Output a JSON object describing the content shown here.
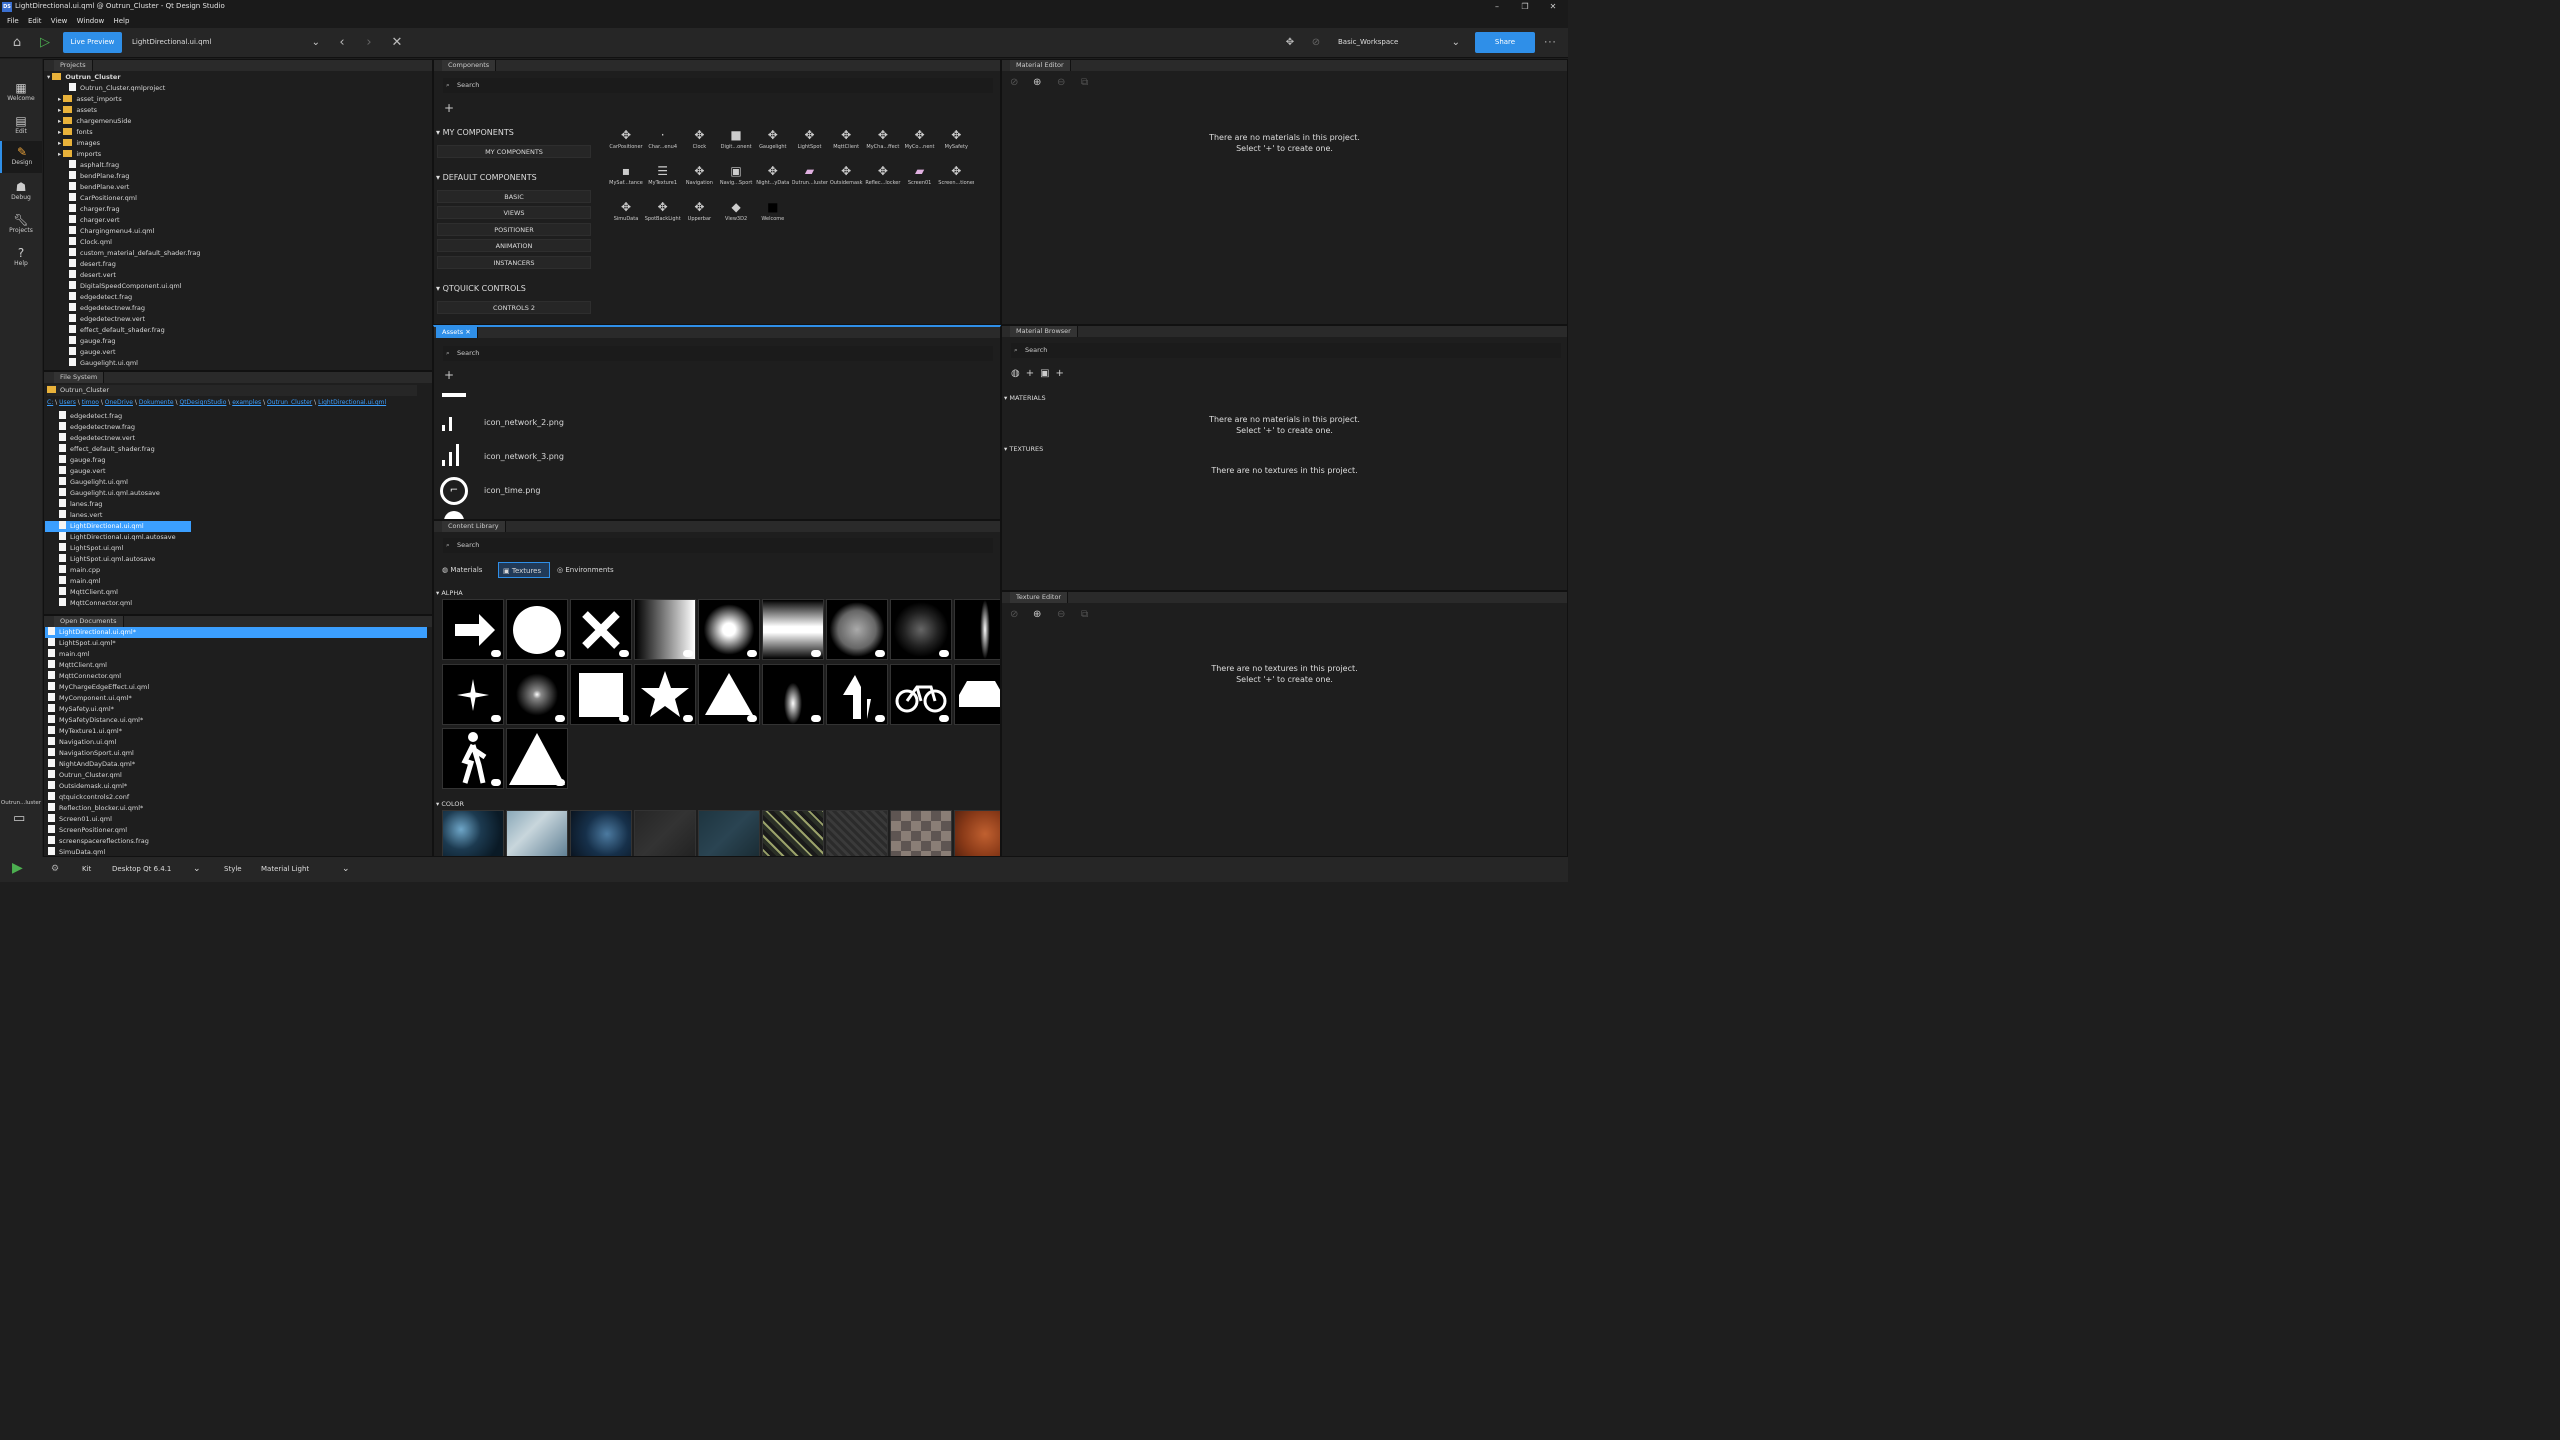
{
  "window": {
    "title": "LightDirectional.ui.qml @ Outrun_Cluster - Qt Design Studio",
    "logo": "DS",
    "controls": [
      "–",
      "❐",
      "✕"
    ]
  },
  "menu": [
    "File",
    "Edit",
    "View",
    "Window",
    "Help"
  ],
  "toolbar": {
    "live_preview": "Live Preview",
    "current_file": "LightDirectional.ui.qml",
    "workspace": "Basic_Workspace",
    "share": "Share"
  },
  "modes": [
    {
      "label": "Welcome",
      "icon": "grid-icon"
    },
    {
      "label": "Edit",
      "icon": "edit-icon"
    },
    {
      "label": "Design",
      "icon": "pencil-icon"
    },
    {
      "label": "Debug",
      "icon": "bug-icon"
    },
    {
      "label": "Projects",
      "icon": "wrench-icon"
    },
    {
      "label": "Help",
      "icon": "help-icon"
    }
  ],
  "modebar_bottom": {
    "project_label": "Outrun...luster"
  },
  "projects": {
    "tab": "Projects",
    "root": "Outrun_Cluster",
    "items": [
      {
        "name": "Outrun_Cluster.qmlproject",
        "type": "file"
      },
      {
        "name": "asset_imports",
        "type": "folder"
      },
      {
        "name": "assets",
        "type": "folder"
      },
      {
        "name": "chargemenuSide",
        "type": "folder"
      },
      {
        "name": "fonts",
        "type": "folder"
      },
      {
        "name": "images",
        "type": "folder"
      },
      {
        "name": "imports",
        "type": "folder"
      },
      {
        "name": "asphalt.frag",
        "type": "file"
      },
      {
        "name": "bendPlane.frag",
        "type": "file"
      },
      {
        "name": "bendPlane.vert",
        "type": "file"
      },
      {
        "name": "CarPositioner.qml",
        "type": "file"
      },
      {
        "name": "charger.frag",
        "type": "file"
      },
      {
        "name": "charger.vert",
        "type": "file"
      },
      {
        "name": "Chargingmenu4.ui.qml",
        "type": "file"
      },
      {
        "name": "Clock.qml",
        "type": "file"
      },
      {
        "name": "custom_material_default_shader.frag",
        "type": "file"
      },
      {
        "name": "desert.frag",
        "type": "file"
      },
      {
        "name": "desert.vert",
        "type": "file"
      },
      {
        "name": "DigitalSpeedComponent.ui.qml",
        "type": "file"
      },
      {
        "name": "edgedetect.frag",
        "type": "file"
      },
      {
        "name": "edgedetectnew.frag",
        "type": "file"
      },
      {
        "name": "edgedetectnew.vert",
        "type": "file"
      },
      {
        "name": "effect_default_shader.frag",
        "type": "file"
      },
      {
        "name": "gauge.frag",
        "type": "file"
      },
      {
        "name": "gauge.vert",
        "type": "file"
      },
      {
        "name": "Gaugelight.ui.qml",
        "type": "file"
      }
    ]
  },
  "filesystem": {
    "tab": "File System",
    "combo": "Outrun_Cluster",
    "path": [
      "C:",
      "Users",
      "timoo",
      "OneDrive",
      "Dokumente",
      "QtDesignStudio",
      "examples",
      "Outrun_Cluster",
      "LightDirectional.ui.qml"
    ],
    "items": [
      "edgedetect.frag",
      "edgedetectnew.frag",
      "edgedetectnew.vert",
      "effect_default_shader.frag",
      "gauge.frag",
      "gauge.vert",
      "Gaugelight.ui.qml",
      "Gaugelight.ui.qml.autosave",
      "lanes.frag",
      "lanes.vert",
      "LightDirectional.ui.qml",
      "LightDirectional.ui.qml.autosave",
      "LightSpot.ui.qml",
      "LightSpot.ui.qml.autosave",
      "main.cpp",
      "main.qml",
      "MqttClient.qml",
      "MqttConnector.qml"
    ],
    "selected": "LightDirectional.ui.qml"
  },
  "open_documents": {
    "tab": "Open Documents",
    "items": [
      "LightDirectional.ui.qml*",
      "LightSpot.ui.qml*",
      "main.qml",
      "MqttClient.qml",
      "MqttConnector.qml",
      "MyChargeEdgeEffect.ui.qml",
      "MyComponent.ui.qml*",
      "MySafety.ui.qml*",
      "MySafetyDistance.ui.qml*",
      "MyTexture1.ui.qml*",
      "Navigation.ui.qml",
      "NavigationSport.ui.qml",
      "NightAndDayData.qml*",
      "Outrun_Cluster.qml",
      "Outsidemask.ui.qml*",
      "qtquickcontrols2.conf",
      "Reflection_blocker.ui.qml*",
      "Screen01.ui.qml",
      "ScreenPositioner.qml",
      "screenspacereflections.frag",
      "SimuData.qml"
    ]
  },
  "components": {
    "tab": "Components",
    "search": "Search",
    "sections": [
      {
        "title": "MY COMPONENTS",
        "buttons": [
          "MY COMPONENTS"
        ]
      },
      {
        "title": "DEFAULT COMPONENTS",
        "buttons": [
          "BASIC",
          "VIEWS",
          "POSITIONER",
          "ANIMATION",
          "INSTANCERS"
        ]
      },
      {
        "title": "QTQUICK CONTROLS",
        "buttons": [
          "CONTROLS 2"
        ]
      },
      {
        "title": "QTQUICK3D",
        "buttons": []
      }
    ],
    "grid": [
      "CarPositioner",
      "Char...enu4",
      "Clock",
      "Digit...onent",
      "Gaugelight",
      "LightSpot",
      "MqttClient",
      "MyCha...ffect",
      "MyCo...nent",
      "MySafety",
      "MySaf...tance",
      "MyTexture1",
      "Navigation",
      "Navig...Sport",
      "Night...yData",
      "Outrun...luster",
      "Outsidemask",
      "Reflec...locker",
      "Screen01",
      "Screen...tioner",
      "SimuData",
      "SpotBackLight",
      "Upperbar",
      "View3D2",
      "Welcome"
    ]
  },
  "assets": {
    "tab": "Assets",
    "search": "Search",
    "items": [
      "icon_network_2.png",
      "icon_network_3.png",
      "icon_time.png"
    ]
  },
  "content_library": {
    "tab": "Content Library",
    "search": "Search",
    "tabs": [
      "Materials",
      "Textures",
      "Environments"
    ],
    "active_tab": "Textures",
    "sections": [
      "ALPHA",
      "COLOR"
    ]
  },
  "material_editor": {
    "tab": "Material Editor",
    "message": [
      "There are no materials in this project.",
      "Select '+' to create one."
    ]
  },
  "material_browser": {
    "tab": "Material Browser",
    "search": "Search",
    "materials_header": "MATERIALS",
    "materials_message": [
      "There are no materials in this project.",
      "Select '+' to create one."
    ],
    "textures_header": "TEXTURES",
    "textures_message": "There are no textures in this project."
  },
  "texture_editor": {
    "tab": "Texture Editor",
    "message": [
      "There are no textures in this project.",
      "Select '+' to create one."
    ]
  },
  "statusbar": {
    "kit_label": "Kit",
    "kit": "Desktop Qt 6.4.1",
    "style_label": "Style",
    "style": "Material Light"
  }
}
